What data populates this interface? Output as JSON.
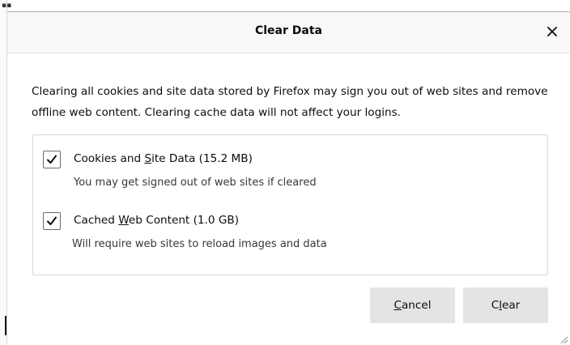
{
  "dialog": {
    "title": "Clear Data",
    "close_icon": "close-icon",
    "description": "Clearing all cookies and site data stored by Firefox may sign you out of web sites and remove offline web content. Clearing cache data will not affect your logins."
  },
  "options": [
    {
      "label_before": "Cookies and ",
      "label_access": "S",
      "label_after": "ite Data (15.2 MB)",
      "description": "You may get signed out of web sites if cleared",
      "checked": true
    },
    {
      "label_before": "Cached ",
      "label_access": "W",
      "label_after": "eb Content (1.0 GB)",
      "description": "Will require web sites to reload images and data",
      "checked": true
    }
  ],
  "buttons": {
    "cancel_access": "C",
    "cancel_rest": "ancel",
    "clear_before": "C",
    "clear_access": "l",
    "clear_after": "ear"
  },
  "icons": {
    "checkmark": "checkmark-icon",
    "resize": "resize-grip-icon"
  },
  "colors": {
    "titlebar_bg": "#f9f9fa",
    "button_bg": "#e4e4e6",
    "border": "#d7d7db",
    "text": "#0c0c0d"
  }
}
